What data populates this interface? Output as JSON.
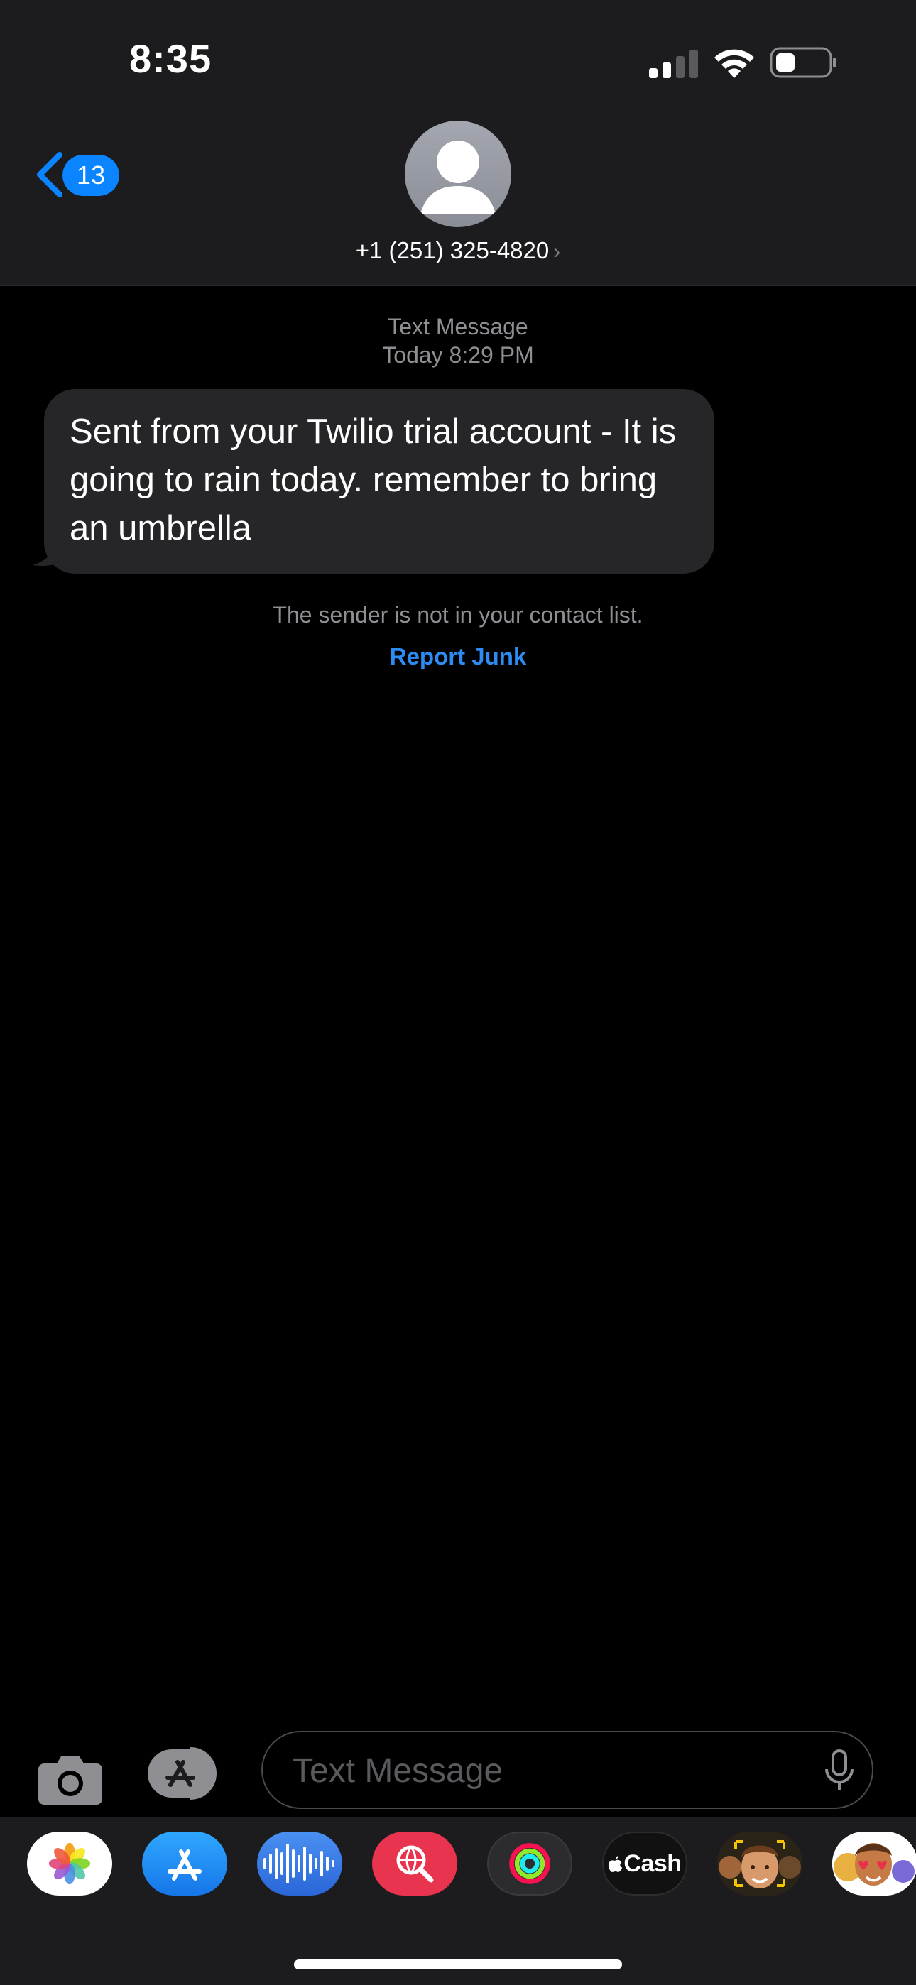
{
  "status_bar": {
    "time": "8:35"
  },
  "header": {
    "back_badge": "13",
    "contact": "+1 (251) 325-4820",
    "contact_chevron": "›"
  },
  "conversation": {
    "service": "Text Message",
    "timestamp": "Today 8:29 PM",
    "message": "Sent from your Twilio trial account - It is going to rain today. remember to bring an umbrella",
    "notice": "The sender is not in your contact list.",
    "report_link": "Report Junk"
  },
  "composer": {
    "placeholder": "Text Message"
  },
  "apps": {
    "cash_label": "Cash"
  },
  "colors": {
    "accent": "#0a84ff",
    "bubble": "#262629",
    "header_bg": "#1c1c1e"
  }
}
